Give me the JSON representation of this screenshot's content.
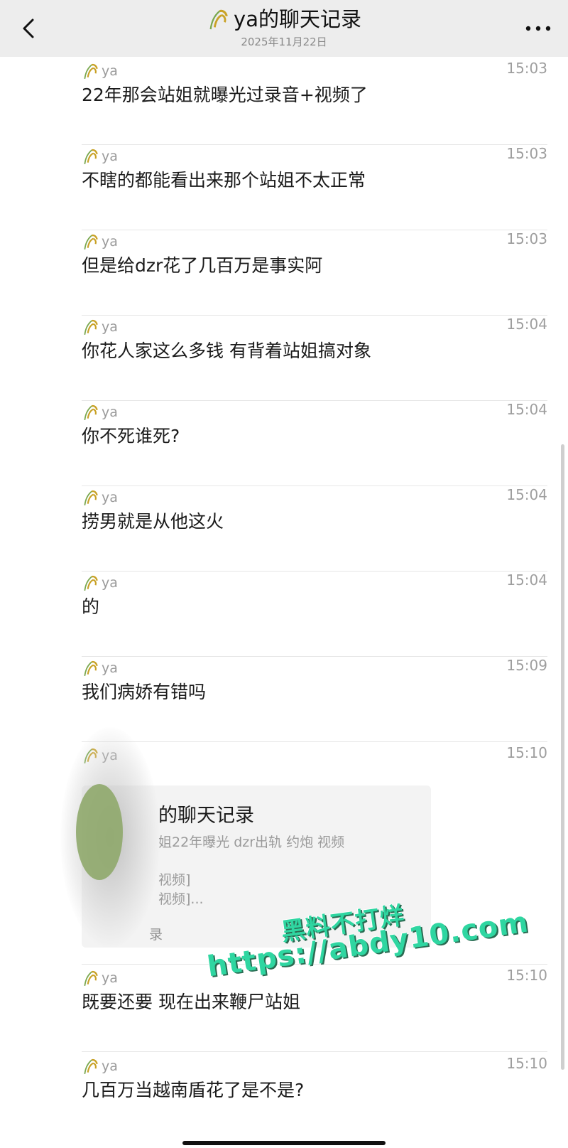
{
  "header": {
    "title": "ya的聊天记录",
    "subtitle": "2025年11月22日",
    "back_icon": "chevron-left-icon",
    "more_icon": "more-dots-icon"
  },
  "messages": [
    {
      "sender": "ya",
      "time": "15:03",
      "text": "22年那会站姐就曝光过录音+视频了"
    },
    {
      "sender": "ya",
      "time": "15:03",
      "text": "不瞎的都能看出来那个站姐不太正常"
    },
    {
      "sender": "ya",
      "time": "15:03",
      "text": "但是给dzr花了几百万是事实阿"
    },
    {
      "sender": "ya",
      "time": "15:04",
      "text": "你花人家这么多钱 有背着站姐搞对象"
    },
    {
      "sender": "ya",
      "time": "15:04",
      "text": "你不死谁死?"
    },
    {
      "sender": "ya",
      "time": "15:04",
      "text": "捞男就是从他这火"
    },
    {
      "sender": "ya",
      "time": "15:04",
      "text": "的"
    },
    {
      "sender": "ya",
      "time": "15:09",
      "text": "我们病娇有错吗"
    }
  ],
  "card_message": {
    "sender": "ya",
    "time": "15:10",
    "card": {
      "title": "的聊天记录",
      "preview": "姐22年曝光 dzr出轨 约炮 视频",
      "line1": "视频]",
      "line2": "视频]...",
      "footer": "录"
    }
  },
  "messages_after": [
    {
      "sender": "ya",
      "time": "15:10",
      "text": "既要还要 现在出来鞭尸站姐"
    },
    {
      "sender": "ya",
      "time": "15:10",
      "text": "几百万当越南盾花了是不是?"
    }
  ],
  "watermark": {
    "line1": "黑料不打烊",
    "line2": "https://abdy10.com"
  },
  "colors": {
    "header_bg": "#ededed",
    "avatar_gold": "#c9a227",
    "avatar_green": "#7aa84f",
    "watermark": "#2fd6a1"
  }
}
